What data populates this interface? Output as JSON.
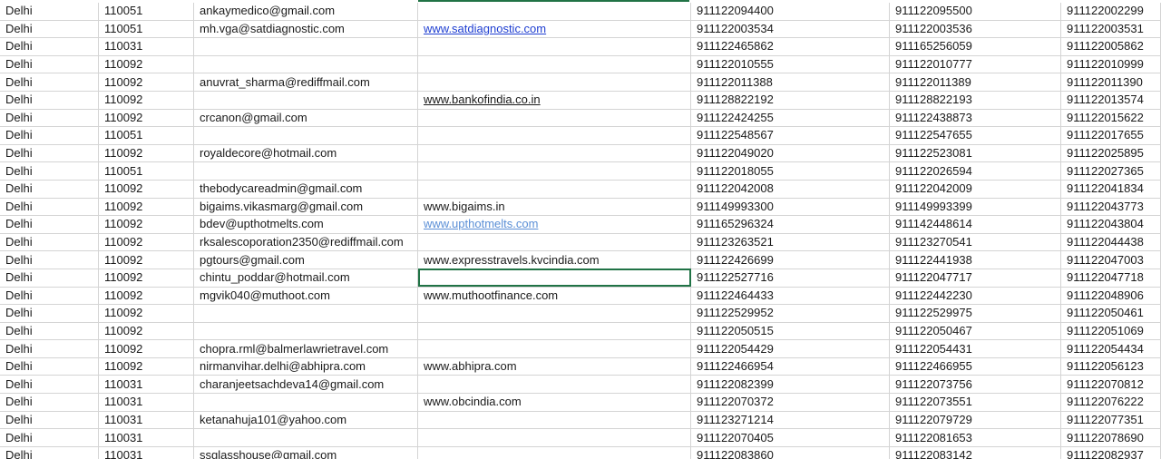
{
  "colors": {
    "selection": "#217346",
    "hyperlink": "#1f3fd1",
    "hyperlink_visited": "#5b8fd6",
    "gridline": "#d4d4d4"
  },
  "rows": [
    {
      "city": "Delhi",
      "pin": "110051",
      "email": "ankaymedico@gmail.com",
      "website": "",
      "website_style": "",
      "phone1": "911122094400",
      "phone2": "911122095500",
      "phone3": "911122002299"
    },
    {
      "city": "Delhi",
      "pin": "110051",
      "email": "mh.vga@satdiagnostic.com",
      "website": "www.satdiagnostic.com",
      "website_style": "link",
      "phone1": "911122003534",
      "phone2": "911122003536",
      "phone3": "911122003531"
    },
    {
      "city": "Delhi",
      "pin": "110031",
      "email": "",
      "website": "",
      "website_style": "",
      "phone1": "911122465862",
      "phone2": "911165256059",
      "phone3": "911122005862"
    },
    {
      "city": "Delhi",
      "pin": "110092",
      "email": "",
      "website": "",
      "website_style": "",
      "phone1": "911122010555",
      "phone2": "911122010777",
      "phone3": "911122010999"
    },
    {
      "city": "Delhi",
      "pin": "110092",
      "email": "anuvrat_sharma@rediffmail.com",
      "website": "",
      "website_style": "",
      "phone1": "911122011388",
      "phone2": "911122011389",
      "phone3": "911122011390"
    },
    {
      "city": "Delhi",
      "pin": "110092",
      "email": "",
      "website": "www.bankofindia.co.in",
      "website_style": "underline",
      "phone1": "911128822192",
      "phone2": "911128822193",
      "phone3": "911122013574"
    },
    {
      "city": "Delhi",
      "pin": "110092",
      "email": "crcanon@gmail.com",
      "website": "",
      "website_style": "",
      "phone1": "911122424255",
      "phone2": "911122438873",
      "phone3": "911122015622"
    },
    {
      "city": "Delhi",
      "pin": "110051",
      "email": "",
      "website": "",
      "website_style": "",
      "phone1": "911122548567",
      "phone2": "911122547655",
      "phone3": "911122017655"
    },
    {
      "city": "Delhi",
      "pin": "110092",
      "email": "royaldecore@hotmail.com",
      "website": "",
      "website_style": "",
      "phone1": "911122049020",
      "phone2": "911122523081",
      "phone3": "911122025895"
    },
    {
      "city": "Delhi",
      "pin": "110051",
      "email": "",
      "website": "",
      "website_style": "",
      "phone1": "911122018055",
      "phone2": "911122026594",
      "phone3": "911122027365"
    },
    {
      "city": "Delhi",
      "pin": "110092",
      "email": "thebodycareadmin@gmail.com",
      "website": "",
      "website_style": "",
      "phone1": "911122042008",
      "phone2": "911122042009",
      "phone3": "911122041834"
    },
    {
      "city": "Delhi",
      "pin": "110092",
      "email": "bigaims.vikasmarg@gmail.com",
      "website": "www.bigaims.in",
      "website_style": "",
      "phone1": "911149993300",
      "phone2": "911149993399",
      "phone3": "911122043773"
    },
    {
      "city": "Delhi",
      "pin": "110092",
      "email": "bdev@upthotmelts.com",
      "website": "www.upthotmelts.com",
      "website_style": "visited",
      "phone1": "911165296324",
      "phone2": "911142448614",
      "phone3": "911122043804"
    },
    {
      "city": "Delhi",
      "pin": "110092",
      "email": "rksalescoporation2350@rediffmail.com",
      "website": "",
      "website_style": "",
      "phone1": "911123263521",
      "phone2": "911123270541",
      "phone3": "911122044438"
    },
    {
      "city": "Delhi",
      "pin": "110092",
      "email": "pgtours@gmail.com",
      "website": "www.expresstravels.kvcindia.com",
      "website_style": "",
      "phone1": "911122426699",
      "phone2": "911122441938",
      "phone3": "911122047003"
    },
    {
      "city": "Delhi",
      "pin": "110092",
      "email": "chintu_poddar@hotmail.com",
      "website": "",
      "website_style": "selected",
      "phone1": "911122527716",
      "phone2": "911122047717",
      "phone3": "911122047718"
    },
    {
      "city": "Delhi",
      "pin": "110092",
      "email": "mgvik040@muthoot.com",
      "website": "www.muthootfinance.com",
      "website_style": "",
      "phone1": "911122464433",
      "phone2": "911122442230",
      "phone3": "911122048906"
    },
    {
      "city": "Delhi",
      "pin": "110092",
      "email": "",
      "website": "",
      "website_style": "",
      "phone1": "911122529952",
      "phone2": "911122529975",
      "phone3": "911122050461"
    },
    {
      "city": "Delhi",
      "pin": "110092",
      "email": "",
      "website": "",
      "website_style": "",
      "phone1": "911122050515",
      "phone2": "911122050467",
      "phone3": "911122051069"
    },
    {
      "city": "Delhi",
      "pin": "110092",
      "email": "chopra.rml@balmerlawrietravel.com",
      "website": "",
      "website_style": "",
      "phone1": "911122054429",
      "phone2": "911122054431",
      "phone3": "911122054434"
    },
    {
      "city": "Delhi",
      "pin": "110092",
      "email": "nirmanvihar.delhi@abhipra.com",
      "website": "www.abhipra.com",
      "website_style": "",
      "phone1": "911122466954",
      "phone2": "911122466955",
      "phone3": "911122056123"
    },
    {
      "city": "Delhi",
      "pin": "110031",
      "email": "charanjeetsachdeva14@gmail.com",
      "website": "",
      "website_style": "",
      "phone1": "911122082399",
      "phone2": "911122073756",
      "phone3": "911122070812"
    },
    {
      "city": "Delhi",
      "pin": "110031",
      "email": "",
      "website": "www.obcindia.com",
      "website_style": "",
      "phone1": "911122070372",
      "phone2": "911122073551",
      "phone3": "911122076222"
    },
    {
      "city": "Delhi",
      "pin": "110031",
      "email": "ketanahuja101@yahoo.com",
      "website": "",
      "website_style": "",
      "phone1": "911123271214",
      "phone2": "911122079729",
      "phone3": "911122077351"
    },
    {
      "city": "Delhi",
      "pin": "110031",
      "email": "",
      "website": "",
      "website_style": "",
      "phone1": "911122070405",
      "phone2": "911122081653",
      "phone3": "911122078690"
    },
    {
      "city": "Delhi",
      "pin": "110031",
      "email": "ssglasshouse@gmail.com",
      "website": "",
      "website_style": "",
      "phone1": "911122083860",
      "phone2": "911122083142",
      "phone3": "911122082937"
    }
  ]
}
